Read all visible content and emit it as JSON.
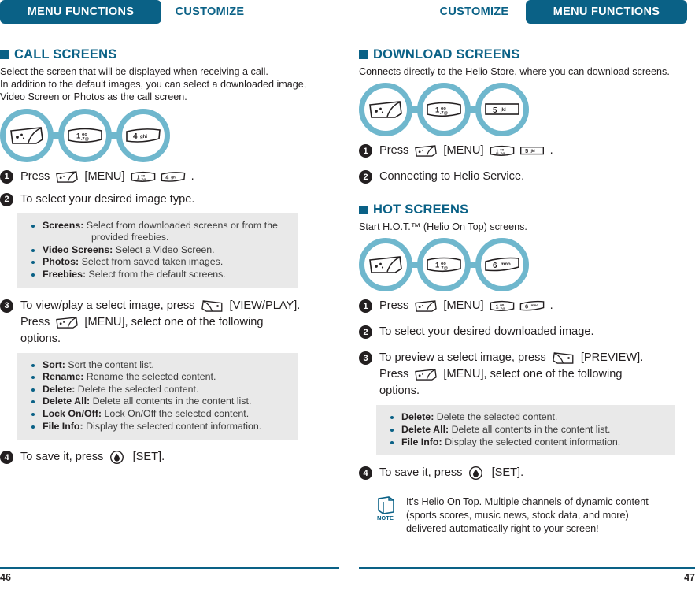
{
  "left_page": {
    "header": {
      "active_tab": "MENU FUNCTIONS",
      "inactive_tab": "CUSTOMIZE"
    },
    "section": {
      "title": "CALL SCREENS",
      "intro": "Select the screen that will be displayed when receiving a call.\nIn addition to the default images, you can select a downloaded image,\nVideo Screen or Photos as the call screen.",
      "flow_keys": [
        "menu-softkey",
        "key-1",
        "key-4-ghi"
      ],
      "steps": [
        {
          "num": "1",
          "parts": [
            {
              "type": "text",
              "value": "Press "
            },
            {
              "type": "key",
              "icon": "menu-softkey"
            },
            {
              "type": "text",
              "value": " [MENU] "
            },
            {
              "type": "key",
              "icon": "key-1"
            },
            {
              "type": "text",
              "value": "  "
            },
            {
              "type": "key",
              "icon": "key-4-ghi"
            },
            {
              "type": "text",
              "value": " ."
            }
          ]
        },
        {
          "num": "2",
          "parts": [
            {
              "type": "text",
              "value": "To select your desired image type."
            }
          ],
          "options": [
            {
              "label": "Screens:",
              "desc": " Select from downloaded screens or from the",
              "cont": "provided freebies."
            },
            {
              "label": "Video Screens:",
              "desc": " Select a Video Screen."
            },
            {
              "label": "Photos:",
              "desc": " Select from saved taken images."
            },
            {
              "label": "Freebies:",
              "desc": " Select from the default screens."
            }
          ]
        },
        {
          "num": "3",
          "parts": [
            {
              "type": "text",
              "value": "To view/play a select image, press "
            },
            {
              "type": "key",
              "icon": "viewplay-softkey"
            },
            {
              "type": "text",
              "value": " [VIEW/PLAY]."
            }
          ],
          "line2": [
            {
              "type": "text",
              "value": "Press "
            },
            {
              "type": "key",
              "icon": "menu-softkey"
            },
            {
              "type": "text",
              "value": " [MENU], select one of the following"
            }
          ],
          "line3": "options.",
          "options": [
            {
              "label": "Sort:",
              "desc": " Sort the content list."
            },
            {
              "label": "Rename:",
              "desc": " Rename the selected content."
            },
            {
              "label": "Delete:",
              "desc": " Delete the selected content."
            },
            {
              "label": "Delete All:",
              "desc": " Delete all contents in the content list."
            },
            {
              "label": "Lock On/Off:",
              "desc": " Lock On/Off the selected content."
            },
            {
              "label": "File Info:",
              "desc": " Display the selected content information."
            }
          ]
        },
        {
          "num": "4",
          "parts": [
            {
              "type": "text",
              "value": "To save it, press "
            },
            {
              "type": "key",
              "icon": "set-key"
            },
            {
              "type": "text",
              "value": "  [SET]."
            }
          ]
        }
      ]
    },
    "page_number": "46"
  },
  "right_page": {
    "header": {
      "active_tab": "MENU FUNCTIONS",
      "inactive_tab": "CUSTOMIZE"
    },
    "section_download": {
      "title": "DOWNLOAD SCREENS",
      "intro": "Connects directly to the Helio Store, where you can download screens.",
      "flow_keys": [
        "menu-softkey",
        "key-1",
        "key-5-jkl"
      ],
      "steps": [
        {
          "num": "1",
          "parts": [
            {
              "type": "text",
              "value": "Press "
            },
            {
              "type": "key",
              "icon": "menu-softkey"
            },
            {
              "type": "text",
              "value": " [MENU] "
            },
            {
              "type": "key",
              "icon": "key-1"
            },
            {
              "type": "text",
              "value": "  "
            },
            {
              "type": "key",
              "icon": "key-5-jkl"
            },
            {
              "type": "text",
              "value": " ."
            }
          ]
        },
        {
          "num": "2",
          "parts": [
            {
              "type": "text",
              "value": "Connecting to Helio Service."
            }
          ]
        }
      ]
    },
    "section_hot": {
      "title": "HOT SCREENS",
      "intro": "Start H.O.T.™ (Helio On Top) screens.",
      "flow_keys": [
        "menu-softkey",
        "key-1",
        "key-6-mno"
      ],
      "steps": [
        {
          "num": "1",
          "parts": [
            {
              "type": "text",
              "value": "Press "
            },
            {
              "type": "key",
              "icon": "menu-softkey"
            },
            {
              "type": "text",
              "value": " [MENU] "
            },
            {
              "type": "key",
              "icon": "key-1"
            },
            {
              "type": "text",
              "value": "  "
            },
            {
              "type": "key",
              "icon": "key-6-mno"
            },
            {
              "type": "text",
              "value": " ."
            }
          ]
        },
        {
          "num": "2",
          "parts": [
            {
              "type": "text",
              "value": "To select your desired downloaded image."
            }
          ]
        },
        {
          "num": "3",
          "parts": [
            {
              "type": "text",
              "value": "To preview a select image, press "
            },
            {
              "type": "key",
              "icon": "preview-softkey"
            },
            {
              "type": "text",
              "value": " [PREVIEW]."
            }
          ],
          "line2": [
            {
              "type": "text",
              "value": "Press "
            },
            {
              "type": "key",
              "icon": "menu-softkey"
            },
            {
              "type": "text",
              "value": " [MENU], select one of the following"
            }
          ],
          "line3": "options.",
          "options": [
            {
              "label": "Delete:",
              "desc": " Delete the selected content."
            },
            {
              "label": "Delete All:",
              "desc": " Delete all contents in the content list."
            },
            {
              "label": "File Info:",
              "desc": " Display the selected content information."
            }
          ]
        },
        {
          "num": "4",
          "parts": [
            {
              "type": "text",
              "value": "To save it, press "
            },
            {
              "type": "key",
              "icon": "set-key"
            },
            {
              "type": "text",
              "value": "  [SET]."
            }
          ]
        }
      ],
      "note": {
        "icon": "note-book-icon",
        "icon_label": "NOTE",
        "text": "It’s Helio On Top. Multiple channels of dynamic content\n(sports scores, music news, stock data, and more)\ndelivered automatically right to your screen!"
      }
    },
    "page_number": "47"
  },
  "colors": {
    "brand_teal": "#0a6186",
    "ring_blue": "#6fb7cd",
    "option_box_bg": "#e9e9e9",
    "body_text": "#231f20"
  }
}
